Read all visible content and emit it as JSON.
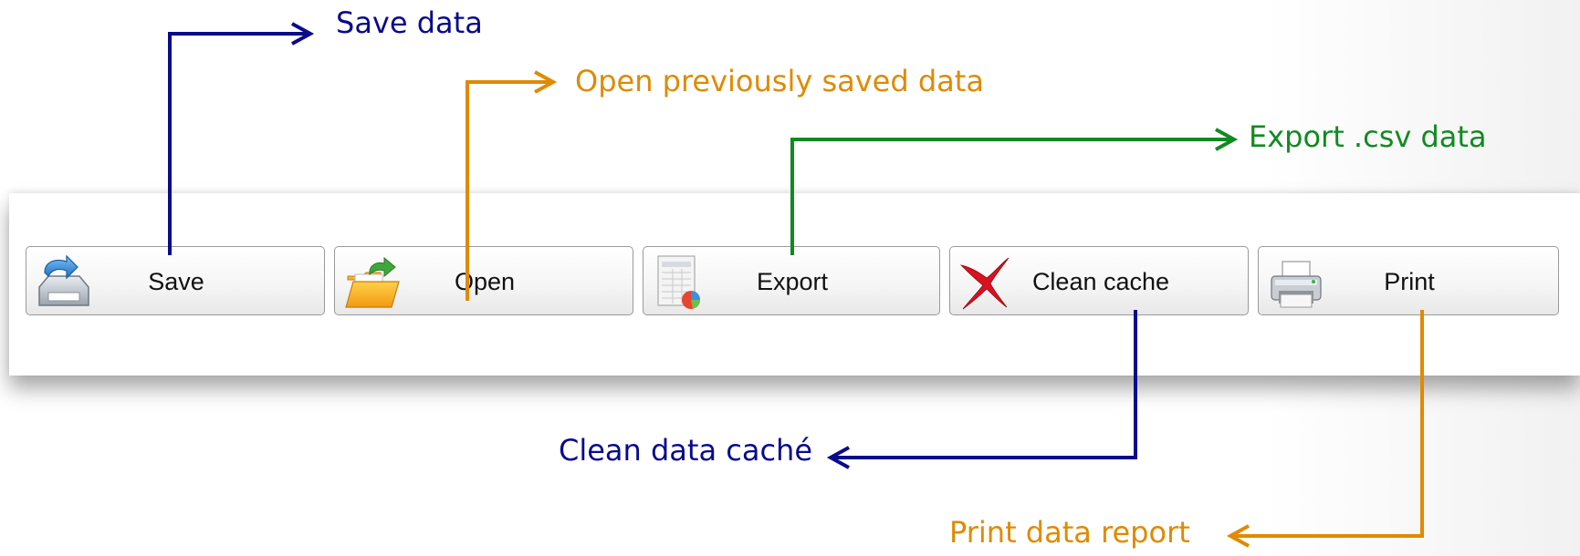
{
  "toolbar": {
    "buttons": [
      {
        "label": "Save",
        "icon": "save-tray-icon"
      },
      {
        "label": "Open",
        "icon": "open-folder-icon"
      },
      {
        "label": "Export",
        "icon": "spreadsheet-export-icon"
      },
      {
        "label": "Clean cache",
        "icon": "red-x-icon"
      },
      {
        "label": "Print",
        "icon": "printer-icon"
      }
    ]
  },
  "annotations": {
    "save": {
      "text": "Save data",
      "color": "#0a0a8c"
    },
    "open": {
      "text": "Open previously saved data",
      "color": "#e08a00"
    },
    "export": {
      "text": "Export .csv data",
      "color": "#118a22"
    },
    "clean": {
      "text": "Clean data caché",
      "color": "#0a0a8c"
    },
    "print": {
      "text": "Print data report",
      "color": "#e08a00"
    }
  }
}
